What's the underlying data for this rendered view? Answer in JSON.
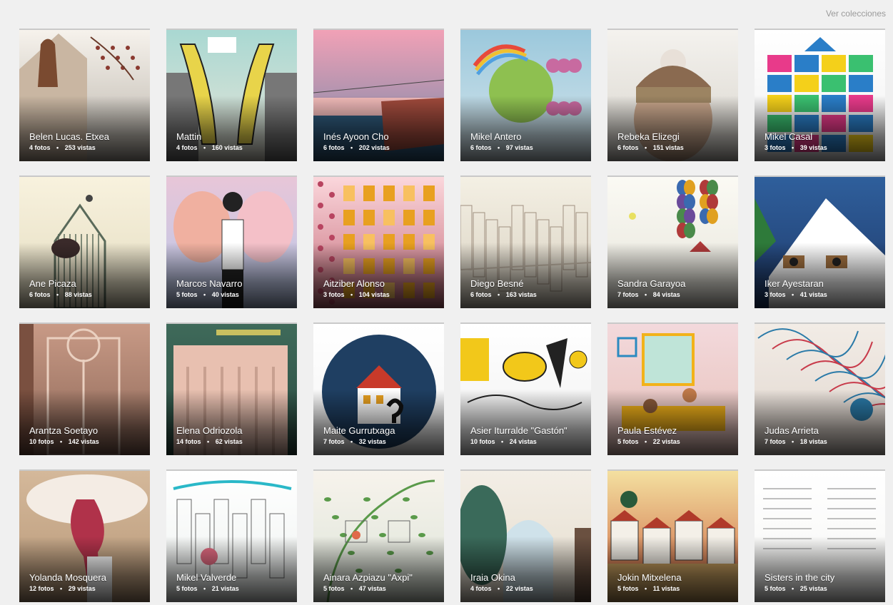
{
  "header": {
    "link_label": "Ver colecciones"
  },
  "units": {
    "photos": "fotos",
    "views": "vistas"
  },
  "collections": [
    {
      "title": "Belen Lucas. Etxea",
      "photos": "4",
      "views": "253",
      "bg": [
        "#f6f2ec",
        "#b8b2a8"
      ],
      "shape": "house",
      "accent": "#7a4a30",
      "accent2": "#d8c2b0"
    },
    {
      "title": "Mattin",
      "photos": "4",
      "views": "160",
      "bg": [
        "#a9d8d2",
        "#e8e5d8"
      ],
      "shape": "figures",
      "accent": "#e8d44a",
      "accent2": "#777777"
    },
    {
      "title": "Inés Ayoon Cho",
      "photos": "6",
      "views": "202",
      "bg": [
        "#f1a1b6",
        "#6f86a8"
      ],
      "shape": "sunset",
      "accent": "#2f5a7c",
      "accent2": "#a04a3c"
    },
    {
      "title": "Mikel Antero",
      "photos": "6",
      "views": "97",
      "bg": [
        "#9bc8dc",
        "#d7e6ec"
      ],
      "shape": "globe",
      "accent": "#8ec050",
      "accent2": "#c86aa0"
    },
    {
      "title": "Rebeka Elizegi",
      "photos": "6",
      "views": "151",
      "bg": [
        "#f4f2ee",
        "#d8d4cc"
      ],
      "shape": "face",
      "accent": "#8a6a50",
      "accent2": "#c6a48a"
    },
    {
      "title": "Mikel Casal",
      "photos": "3",
      "views": "39",
      "bg": [
        "#ffffff",
        "#f0f0f0"
      ],
      "shape": "blocks",
      "accent": "#2a7ec8",
      "accent2": "#e83a8a"
    },
    {
      "title": "Ane Picaza",
      "photos": "6",
      "views": "88",
      "bg": [
        "#f8f2de",
        "#e4dcc0"
      ],
      "shape": "cage",
      "accent": "#5a6a5a",
      "accent2": "#3a2a2a"
    },
    {
      "title": "Marcos Navarro",
      "photos": "5",
      "views": "40",
      "bg": [
        "#e8c6d8",
        "#b6c8ea"
      ],
      "shape": "dancers",
      "accent": "#f0b0a0",
      "accent2": "#222222"
    },
    {
      "title": "Aitziber Alonso",
      "photos": "3",
      "views": "104",
      "bg": [
        "#fbd7dc",
        "#c46a78"
      ],
      "shape": "windows",
      "accent": "#e8a020",
      "accent2": "#b84460"
    },
    {
      "title": "Diego Besné",
      "photos": "6",
      "views": "163",
      "bg": [
        "#f4f0e4",
        "#d8d0c0"
      ],
      "shape": "city",
      "accent": "#a09080",
      "accent2": "#c0b4a4"
    },
    {
      "title": "Sandra Garayoa",
      "photos": "7",
      "views": "84",
      "bg": [
        "#fbfaf4",
        "#e6e4da"
      ],
      "shape": "balloons",
      "accent": "#3a6ab0",
      "accent2": "#b03a3a"
    },
    {
      "title": "Iker Ayestaran",
      "photos": "3",
      "views": "41",
      "bg": [
        "#2f5f9c",
        "#1f3a6a"
      ],
      "shape": "roof",
      "accent": "#ffffff",
      "accent2": "#2e7a3a"
    },
    {
      "title": "Arantza Soetayo",
      "photos": "10",
      "views": "142",
      "bg": [
        "#c89a86",
        "#8c6656"
      ],
      "shape": "door",
      "accent": "#ead0c0",
      "accent2": "#7a5040"
    },
    {
      "title": "Elena Odriozola",
      "photos": "14",
      "views": "62",
      "bg": [
        "#3f6a5a",
        "#2a4a40"
      ],
      "shape": "forest",
      "accent": "#e8c0b0",
      "accent2": "#c8a090"
    },
    {
      "title": "Maite Gurrutxaga",
      "photos": "7",
      "views": "32",
      "bg": [
        "#ffffff",
        "#f4f4f4"
      ],
      "shape": "nighthouse",
      "accent": "#1f3f62",
      "accent2": "#c83a2a"
    },
    {
      "title": "Asier Iturralde \"Gastón\"",
      "photos": "10",
      "views": "24",
      "bg": [
        "#ffffff",
        "#f0f0f0"
      ],
      "shape": "comic",
      "accent": "#f2c81a",
      "accent2": "#222222"
    },
    {
      "title": "Paula Estévez",
      "photos": "5",
      "views": "22",
      "bg": [
        "#f3d9dc",
        "#e6c0b8"
      ],
      "shape": "room",
      "accent": "#f2b21a",
      "accent2": "#2a8ac0"
    },
    {
      "title": "Judas Arrieta",
      "photos": "7",
      "views": "18",
      "bg": [
        "#f2ece6",
        "#e0d6ce"
      ],
      "shape": "scribble",
      "accent": "#c83a4a",
      "accent2": "#2a7aa8"
    },
    {
      "title": "Yolanda Mosquera",
      "photos": "12",
      "views": "29",
      "bg": [
        "#d4b89a",
        "#b89878"
      ],
      "shape": "tree",
      "accent": "#b0324a",
      "accent2": "#f4ece4"
    },
    {
      "title": "Mikel Valverde",
      "photos": "5",
      "views": "21",
      "bg": [
        "#ffffff",
        "#eef2f0"
      ],
      "shape": "sketch",
      "accent": "#2ab8c8",
      "accent2": "#e06a80"
    },
    {
      "title": "Ainara Azpiazu \"Axpi\"",
      "photos": "5",
      "views": "47",
      "bg": [
        "#f7f3ec",
        "#dce4d8"
      ],
      "shape": "vines",
      "accent": "#5a9a4a",
      "accent2": "#e06a4a"
    },
    {
      "title": "Iraia Okina",
      "photos": "4",
      "views": "22",
      "bg": [
        "#f3eee6",
        "#e4dccc"
      ],
      "shape": "arch",
      "accent": "#3a6a5a",
      "accent2": "#6a5040"
    },
    {
      "title": "Jokin Mitxelena",
      "photos": "5",
      "views": "11",
      "bg": [
        "#f4e0a0",
        "#c85a3a"
      ],
      "shape": "village",
      "accent": "#2a5a3a",
      "accent2": "#f4f0e8"
    },
    {
      "title": "Sisters in the city",
      "photos": "5",
      "views": "25",
      "bg": [
        "#ffffff",
        "#f6f6f4"
      ],
      "shape": "text",
      "accent": "#555555",
      "accent2": "#999999"
    }
  ]
}
